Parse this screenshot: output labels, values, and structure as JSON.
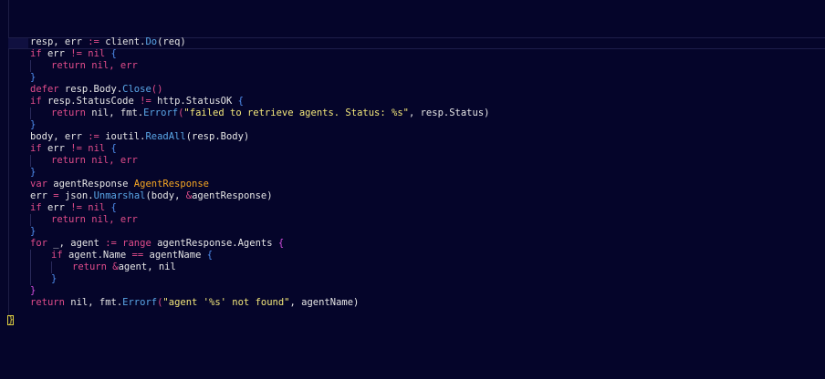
{
  "code_lines": [
    [
      "resp, err ",
      ":=",
      " client.",
      "Do",
      "(req)"
    ],
    [
      "if",
      " err ",
      "!=",
      " nil ",
      "{"
    ],
    [
      "return",
      " nil, err"
    ],
    [
      "}"
    ],
    [
      "defer",
      " resp.Body.",
      "Close",
      "()"
    ],
    [
      "if",
      " resp.StatusCode ",
      "!=",
      " http.StatusOK ",
      "{"
    ],
    [
      "return",
      " nil, fmt.",
      "Errorf",
      "(",
      "\"failed to retrieve agents. Status: %s\"",
      ", resp.Status)"
    ],
    [
      "}"
    ],
    [
      "body, err ",
      ":=",
      " ioutil.",
      "ReadAll",
      "(resp.Body)"
    ],
    [
      "if",
      " err ",
      "!=",
      " nil ",
      "{"
    ],
    [
      "return",
      " nil, err"
    ],
    [
      "}"
    ],
    [
      "var",
      " agentResponse ",
      "AgentResponse"
    ],
    [
      "err ",
      "=",
      " json.",
      "Unmarshal",
      "(body, ",
      "&",
      "agentResponse)"
    ],
    [
      "if",
      " err ",
      "!=",
      " nil ",
      "{"
    ],
    [
      "return",
      " nil, err"
    ],
    [
      "}"
    ],
    [
      "for",
      " _, agent ",
      ":=",
      " range",
      " agentResponse.Agents ",
      "{"
    ],
    [
      "if",
      " agent.Name ",
      "==",
      " agentName ",
      "{"
    ],
    [
      "return",
      " ",
      "&",
      "agent, nil"
    ],
    [
      "}"
    ],
    [
      "}"
    ],
    [
      "return",
      " nil, fmt.",
      "Errorf",
      "(",
      "\"agent '%s' not found\"",
      ", agentName)"
    ]
  ],
  "closing_brace": "}"
}
